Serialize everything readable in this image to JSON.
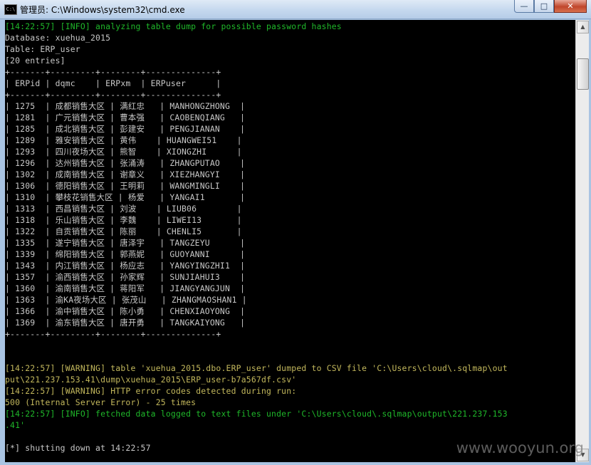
{
  "window": {
    "title": "管理员: C:\\Windows\\system32\\cmd.exe",
    "icon_label": "C:\\",
    "controls": {
      "minimize": "—",
      "maximize": "□",
      "close": "✕"
    }
  },
  "console": {
    "lines": [
      {
        "text": "[14:22:57] [INFO] analyzing table dump for possible password hashes",
        "color": "info"
      },
      {
        "text": "Database: xuehua_2015",
        "color": "white"
      },
      {
        "text": "Table: ERP_user",
        "color": "white"
      },
      {
        "text": "[20 entries]",
        "color": "white"
      },
      {
        "text": "+-------+---------+--------+--------------+",
        "color": "white"
      },
      {
        "text": "| ERPid | dqmc    | ERPxm  | ERPuser      |",
        "color": "white"
      },
      {
        "text": "+-------+---------+--------+--------------+",
        "color": "white"
      },
      {
        "text": "| 1275  | 成都销售大区 | 满红忠   | MANHONGZHONG  |",
        "color": "white"
      },
      {
        "text": "| 1281  | 广元销售大区 | 曹本强   | CAOBENQIANG   |",
        "color": "white"
      },
      {
        "text": "| 1285  | 成北销售大区 | 彭建安   | PENGJIANAN    |",
        "color": "white"
      },
      {
        "text": "| 1289  | 雅安销售大区 | 黄伟    | HUANGWEI51    |",
        "color": "white"
      },
      {
        "text": "| 1293  | 四川夜场大区 | 熊智    | XIONGZHI      |",
        "color": "white"
      },
      {
        "text": "| 1296  | 达州销售大区 | 张涌涛   | ZHANGPUTAO    |",
        "color": "white"
      },
      {
        "text": "| 1302  | 成南销售大区 | 谢章义   | XIEZHANGYI    |",
        "color": "white"
      },
      {
        "text": "| 1306  | 德阳销售大区 | 王明莉   | WANGMINGLI    |",
        "color": "white"
      },
      {
        "text": "| 1310  | 攀枝花销售大区 | 杨爱   | YANGAI1       |",
        "color": "white"
      },
      {
        "text": "| 1313  | 西昌销售大区 | 刘波    | LIUB06        |",
        "color": "white"
      },
      {
        "text": "| 1318  | 乐山销售大区 | 李魏    | LIWEI13       |",
        "color": "white"
      },
      {
        "text": "| 1322  | 自贡销售大区 | 陈丽    | CHENLI5       |",
        "color": "white"
      },
      {
        "text": "| 1335  | 遂宁销售大区 | 唐泽宇   | TANGZEYU      |",
        "color": "white"
      },
      {
        "text": "| 1339  | 绵阳销售大区 | 郭燕妮   | GUOYANNI      |",
        "color": "white"
      },
      {
        "text": "| 1343  | 内江销售大区 | 杨应志   | YANGYINGZHI1  |",
        "color": "white"
      },
      {
        "text": "| 1357  | 渝西销售大区 | 孙家辉   | SUNJIAHUI3    |",
        "color": "white"
      },
      {
        "text": "| 1360  | 渝南销售大区 | 蒋阳军   | JIANGYANGJUN  |",
        "color": "white"
      },
      {
        "text": "| 1363  | 渝KA夜场大区 | 张茂山   | ZHANGMAOSHAN1 |",
        "color": "white"
      },
      {
        "text": "| 1366  | 渝中销售大区 | 陈小勇   | CHENXIAOYONG  |",
        "color": "white"
      },
      {
        "text": "| 1369  | 渝东销售大区 | 唐开勇   | TANGKAIYONG   |",
        "color": "white"
      },
      {
        "text": "+-------+---------+--------+--------------+",
        "color": "white"
      },
      {
        "text": "",
        "color": "white"
      },
      {
        "text": "",
        "color": "white"
      },
      {
        "text": "[14:22:57] [WARNING] table 'xuehua_2015.dbo.ERP_user' dumped to CSV file 'C:\\Users\\cloud\\.sqlmap\\out",
        "color": "warn"
      },
      {
        "text": "put\\221.237.153.41\\dump\\xuehua_2015\\ERP_user-b7a567df.csv'",
        "color": "warn"
      },
      {
        "text": "[14:22:57] [WARNING] HTTP error codes detected during run:",
        "color": "warn"
      },
      {
        "text": "500 (Internal Server Error) - 25 times",
        "color": "warn"
      },
      {
        "text": "[14:22:57] [INFO] fetched data logged to text files under 'C:\\Users\\cloud\\.sqlmap\\output\\221.237.153",
        "color": "info"
      },
      {
        "text": ".41'",
        "color": "info"
      },
      {
        "text": "",
        "color": "white"
      },
      {
        "text": "[*] shutting down at 14:22:57",
        "color": "white"
      }
    ]
  },
  "scrollbar": {
    "up_arrow": "▲",
    "down_arrow": "▼"
  },
  "watermark": "www.wooyun.org"
}
